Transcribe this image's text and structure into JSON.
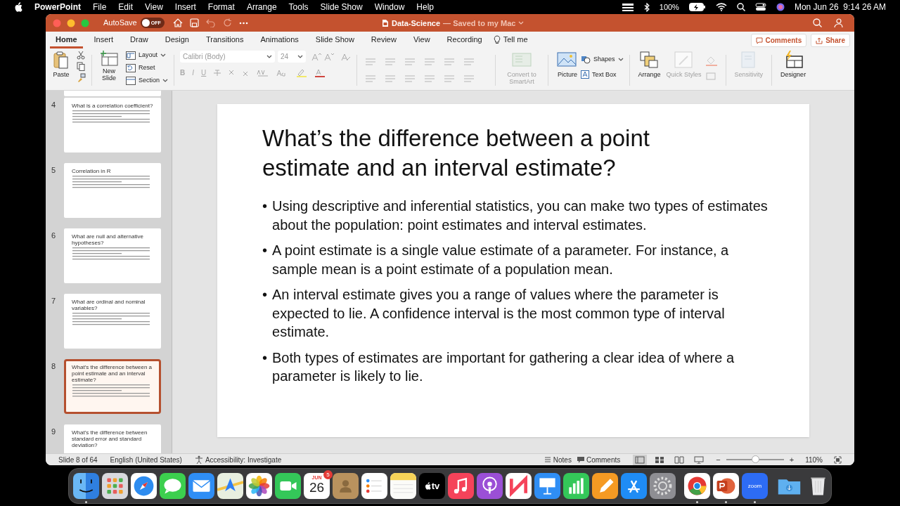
{
  "menu_bar": {
    "app": "PowerPoint",
    "items": [
      "File",
      "Edit",
      "View",
      "Insert",
      "Format",
      "Arrange",
      "Tools",
      "Slide Show",
      "Window",
      "Help"
    ],
    "battery": "100%",
    "clock": "Mon Jun 26  9:14 26 AM"
  },
  "title_bar": {
    "autosave": "AutoSave",
    "autosave_toggle": {
      "label": "OFF",
      "on": false
    },
    "title": "Data-Science",
    "subtitle": "— Saved to my Mac"
  },
  "ribbon": {
    "tabs": [
      {
        "label": "Home",
        "selected": true
      },
      {
        "label": "Insert",
        "selected": false
      },
      {
        "label": "Draw",
        "selected": false
      },
      {
        "label": "Design",
        "selected": false
      },
      {
        "label": "Transitions",
        "selected": false
      },
      {
        "label": "Animations",
        "selected": false
      },
      {
        "label": "Slide Show",
        "selected": false
      },
      {
        "label": "Review",
        "selected": false
      },
      {
        "label": "View",
        "selected": false
      },
      {
        "label": "Recording",
        "selected": false
      }
    ],
    "tell_me": "Tell me",
    "comments_button": "Comments",
    "share_button": "Share",
    "paste": "Paste",
    "new_slide": "New Slide",
    "slide_commands": [
      {
        "label": "Layout",
        "dropdown": true
      },
      {
        "label": "Reset",
        "dropdown": false
      },
      {
        "label": "Section",
        "dropdown": true
      }
    ],
    "font": {
      "name": "Calibri (Body)",
      "size": "24",
      "format_buttons": [
        "B",
        "I",
        "U"
      ]
    },
    "large_buttons": [
      {
        "kind": "smartart",
        "label": "Convert to SmartArt",
        "disabled": true
      },
      {
        "kind": "picture",
        "label": "Picture",
        "disabled": false
      },
      {
        "kind": "arrange",
        "label": "Arrange",
        "disabled": false
      },
      {
        "kind": "quickstyles",
        "label": "Quick Styles",
        "disabled": true
      },
      {
        "kind": "sensitivity",
        "label": "Sensitivity",
        "disabled": true
      },
      {
        "kind": "designer",
        "label": "Designer",
        "disabled": false
      }
    ],
    "shapes": "Shapes",
    "text_box": "Text Box"
  },
  "thumbnails": [
    {
      "selected": false
    },
    {
      "number": "4",
      "title": "What is a correlation coefficient?",
      "selected": false
    },
    {
      "number": "5",
      "title": "Correlation in R",
      "selected": false
    },
    {
      "number": "6",
      "title": "What are null and alternative hypotheses?",
      "selected": false
    },
    {
      "number": "7",
      "title": "What are ordinal and nominal variables?",
      "selected": false
    },
    {
      "number": "8",
      "title": "What’s the difference between a point estimate and an interval estimate?",
      "selected": true
    },
    {
      "number": "9",
      "title": "What’s the difference between standard error and standard deviation?",
      "selected": false
    }
  ],
  "slide": {
    "title": "What’s the difference between a point estimate and an interval estimate?",
    "bullet": "•",
    "bullets": [
      "Using descriptive and inferential statistics, you can make two types of estimates about the population: point estimates and interval estimates.",
      "A point estimate is a single value estimate of a parameter. For instance, a sample mean is a point estimate of a population mean.",
      "An interval estimate gives you a range of values where the parameter is expected to lie. A confidence interval is the most common type of interval estimate.",
      "Both types of estimates are important for gathering a clear idea of where a parameter is likely to lie."
    ]
  },
  "status_bar": {
    "slide": "Slide 8 of 64",
    "language": "English (United States)",
    "accessibility": "Accessibility: Investigate",
    "notes": "Notes",
    "comments": "Comments",
    "views": [
      {
        "kind": "normal",
        "selected": true
      },
      {
        "kind": "sorter",
        "selected": false
      },
      {
        "kind": "reading",
        "selected": false
      },
      {
        "kind": "slideshow",
        "selected": false
      }
    ],
    "zoom_out": "−",
    "zoom_in": "+",
    "zoom": {
      "level": 0.5
    },
    "zoom_reading": "110%"
  },
  "dock": {
    "items": [
      {
        "kind": "finder",
        "running": true
      },
      {
        "kind": "launchpad",
        "running": false
      },
      {
        "kind": "safari",
        "running": false
      },
      {
        "kind": "messages",
        "running": false
      },
      {
        "kind": "mail",
        "running": false
      },
      {
        "kind": "maps",
        "running": false
      },
      {
        "kind": "photos",
        "running": false
      },
      {
        "kind": "facetime",
        "running": false
      },
      {
        "kind": "calendar",
        "running": false,
        "month": "JUN",
        "day": "26",
        "badge": "5"
      },
      {
        "kind": "contacts",
        "running": false
      },
      {
        "kind": "reminders",
        "running": false
      },
      {
        "kind": "notes",
        "running": false
      },
      {
        "kind": "tv",
        "running": false,
        "label": "tv"
      },
      {
        "kind": "music",
        "running": false
      },
      {
        "kind": "podcasts",
        "running": false
      },
      {
        "kind": "news",
        "running": false
      },
      {
        "kind": "keynote",
        "running": false
      },
      {
        "kind": "numbers",
        "running": false
      },
      {
        "kind": "pages",
        "running": false
      },
      {
        "kind": "appstore",
        "running": false
      },
      {
        "kind": "settings",
        "running": false
      },
      {
        "kind": "separator"
      },
      {
        "kind": "chrome",
        "running": true
      },
      {
        "kind": "powerpoint",
        "running": true
      },
      {
        "kind": "zoom",
        "running": true,
        "label": "zoom"
      },
      {
        "kind": "separator"
      },
      {
        "kind": "downloads",
        "running": false
      },
      {
        "kind": "trash",
        "running": false
      }
    ]
  }
}
